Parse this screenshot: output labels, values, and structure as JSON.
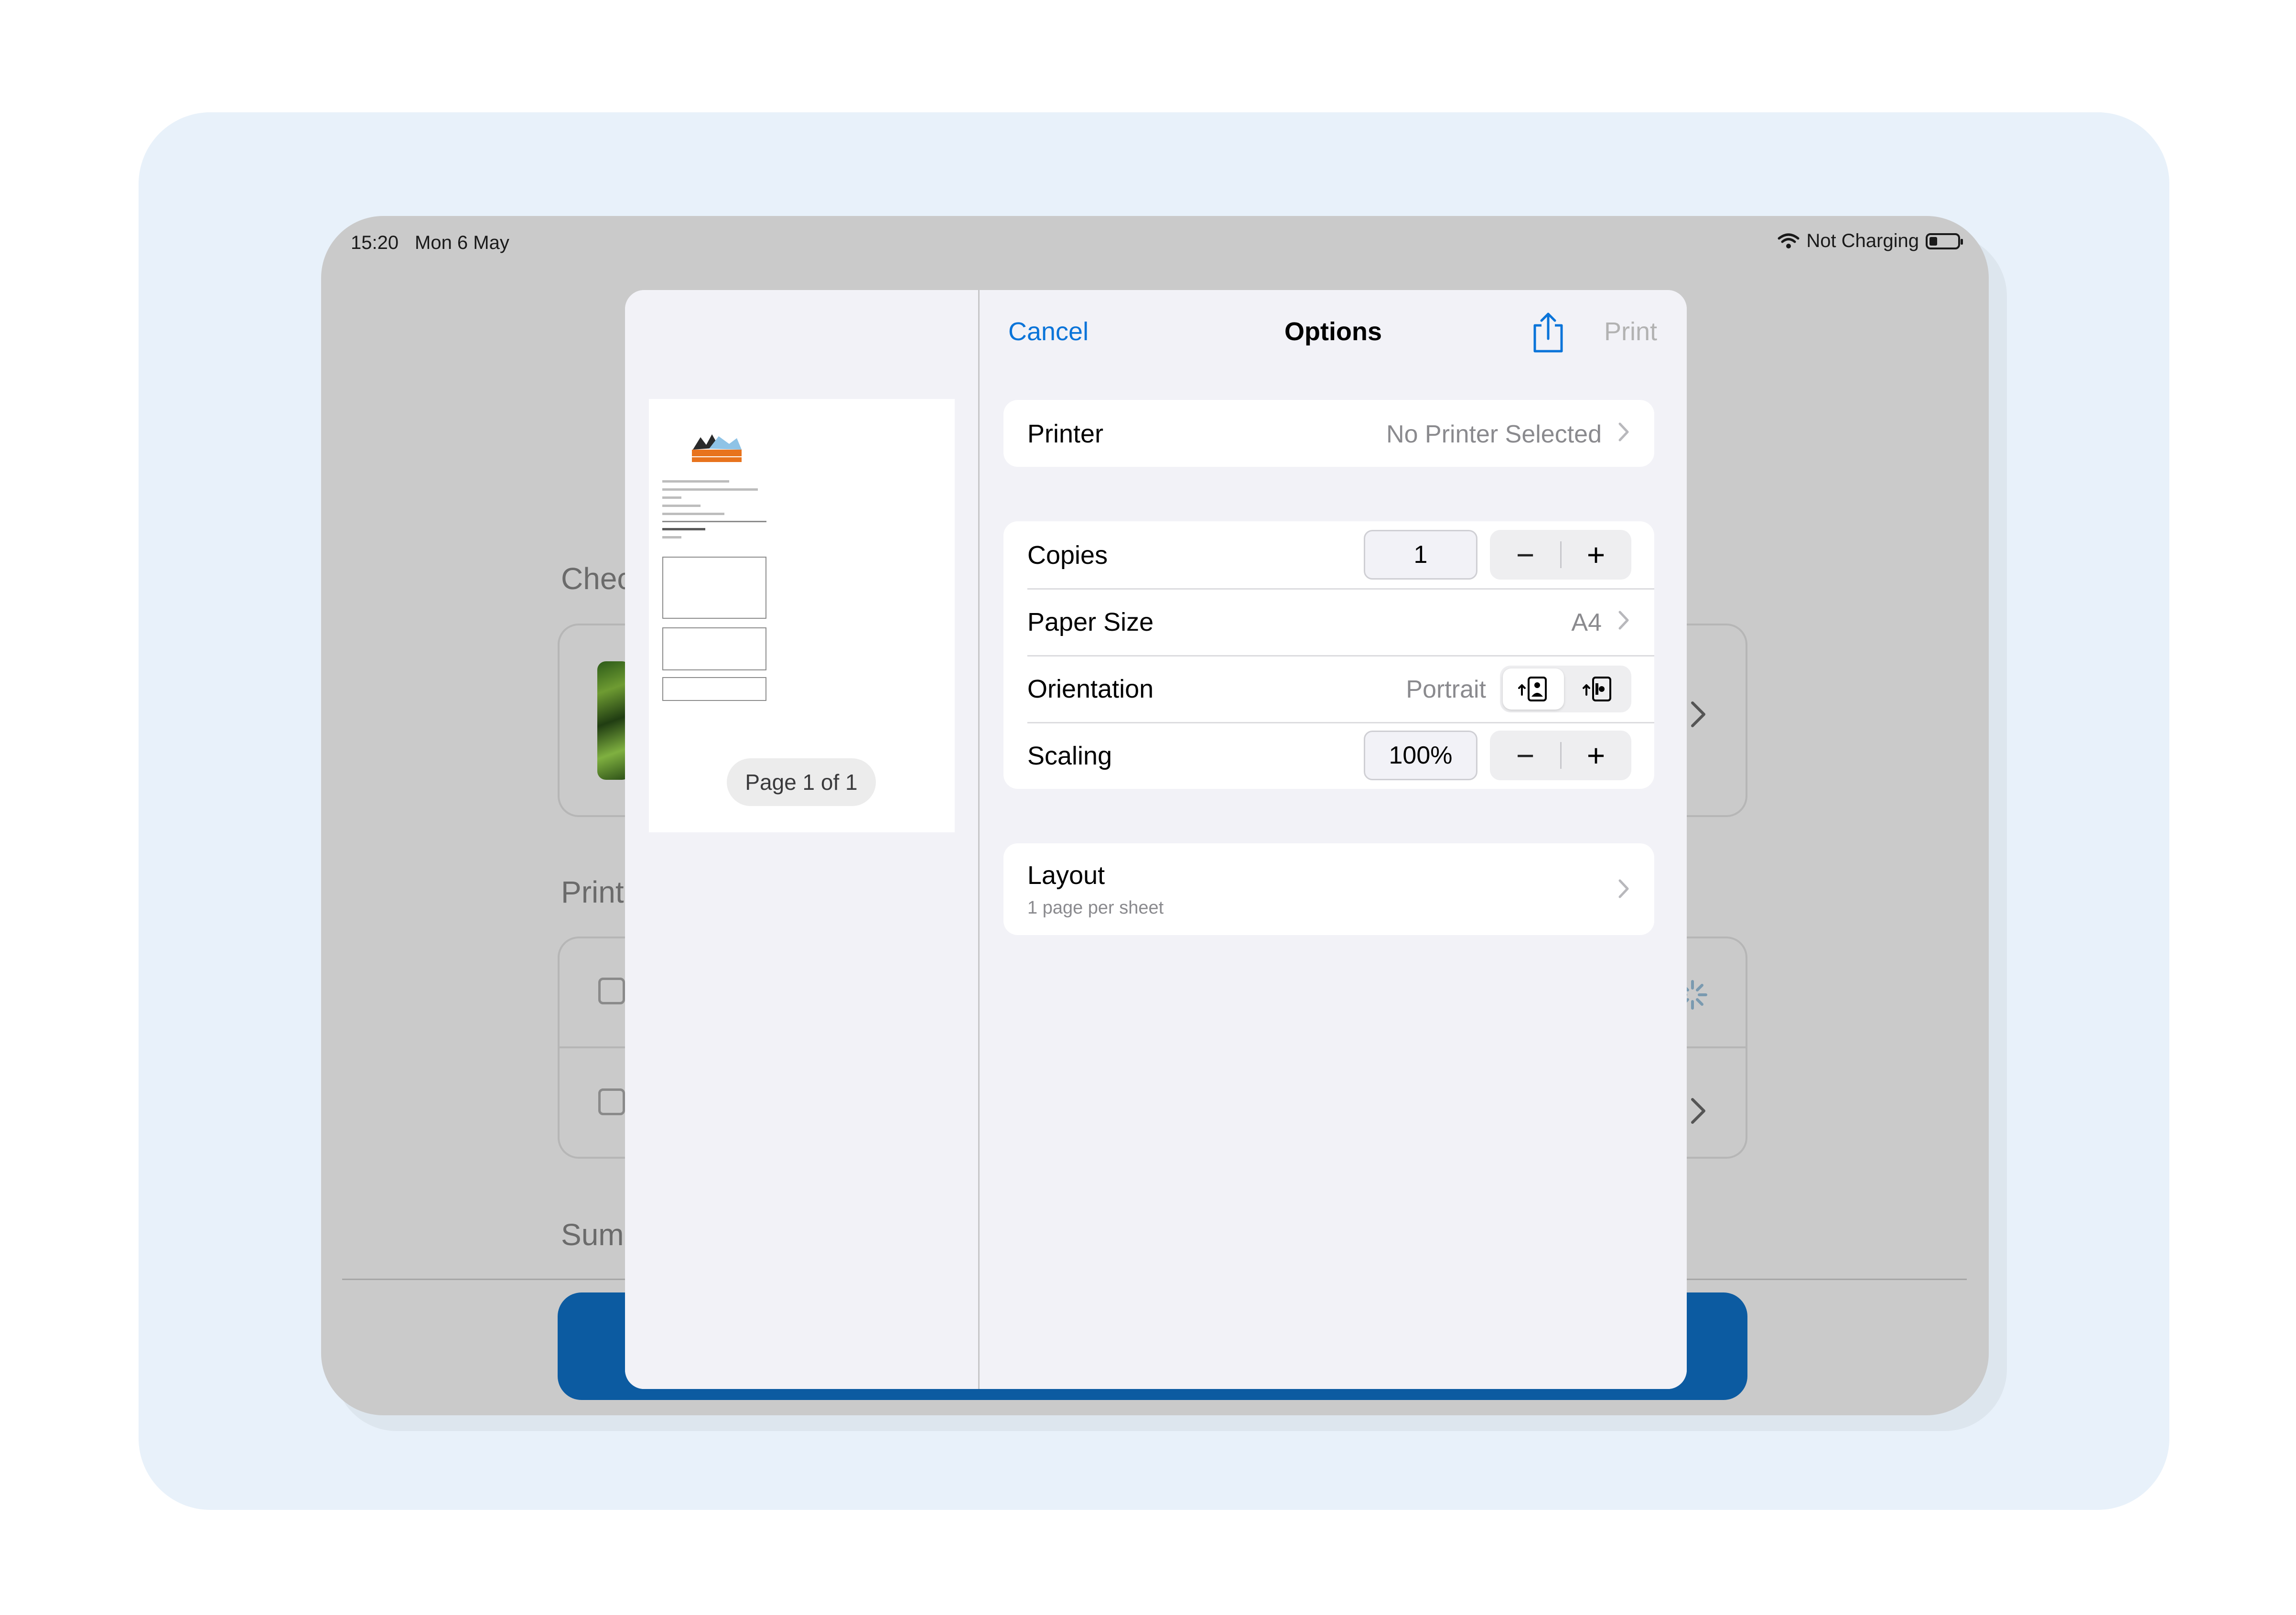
{
  "status_bar": {
    "time": "15:20",
    "date": "Mon 6 May",
    "charging": "Not Charging"
  },
  "background_app": {
    "section_checkout": "Chec",
    "section_print": "Print",
    "section_summary": "Sum"
  },
  "preview": {
    "page_indicator": "Page 1 of 1"
  },
  "options": {
    "cancel_label": "Cancel",
    "title": "Options",
    "print_label": "Print",
    "printer": {
      "label": "Printer",
      "value": "No Printer Selected"
    },
    "copies": {
      "label": "Copies",
      "value": "1",
      "minus": "−",
      "plus": "+"
    },
    "paper_size": {
      "label": "Paper Size",
      "value": "A4"
    },
    "orientation": {
      "label": "Orientation",
      "value": "Portrait"
    },
    "scaling": {
      "label": "Scaling",
      "value": "100%",
      "minus": "−",
      "plus": "+"
    },
    "layout": {
      "label": "Layout",
      "subtitle": "1 page per sheet"
    }
  },
  "colors": {
    "accent": "#0a74d9",
    "app_button": "#0c5ba1",
    "disabled": "#b2b2b2"
  }
}
